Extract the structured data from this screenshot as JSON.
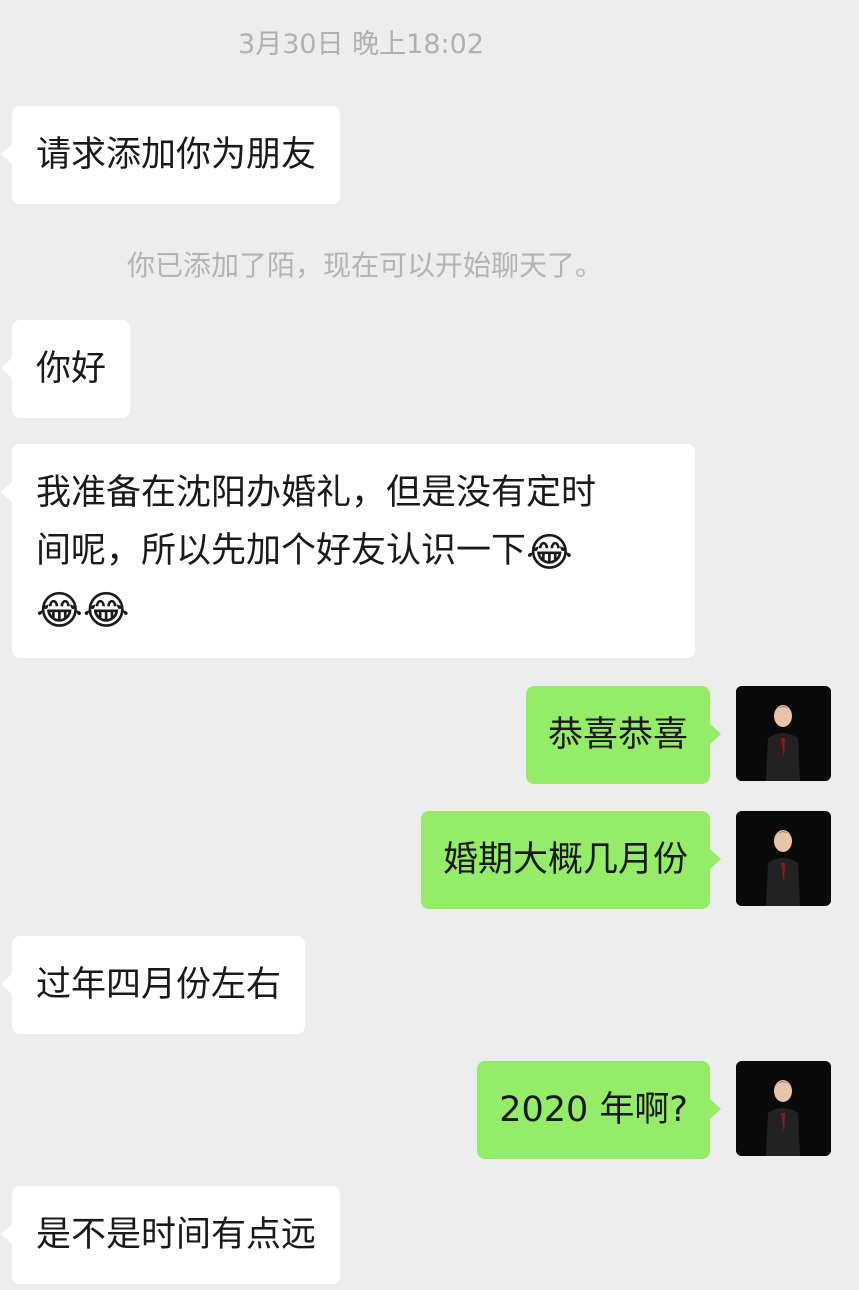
{
  "timestamp": "3月30日 晚上18:02",
  "system_notice": "你已添加了陌，现在可以开始聊天了。",
  "messages": [
    {
      "side": "in",
      "text": "请求添加你为朋友"
    },
    {
      "side": "in",
      "text": "你好"
    },
    {
      "side": "in",
      "line1": "我准备在沈阳办婚礼，但是没有定时",
      "line2": "间呢，所以先加个好友认识一下",
      "emoji": "😂"
    },
    {
      "side": "out",
      "text": "恭喜恭喜"
    },
    {
      "side": "out",
      "text": "婚期大概几月份"
    },
    {
      "side": "in",
      "text": "过年四月份左右"
    },
    {
      "side": "out",
      "text": "2020 年啊?"
    },
    {
      "side": "in",
      "text": "是不是时间有点远"
    }
  ],
  "colors": {
    "background": "#ededed",
    "incoming_bubble": "#ffffff",
    "outgoing_bubble": "#95ec69"
  },
  "icons": {
    "emoji": "facepalm-laughing-emoji",
    "avatar": "user-avatar"
  }
}
